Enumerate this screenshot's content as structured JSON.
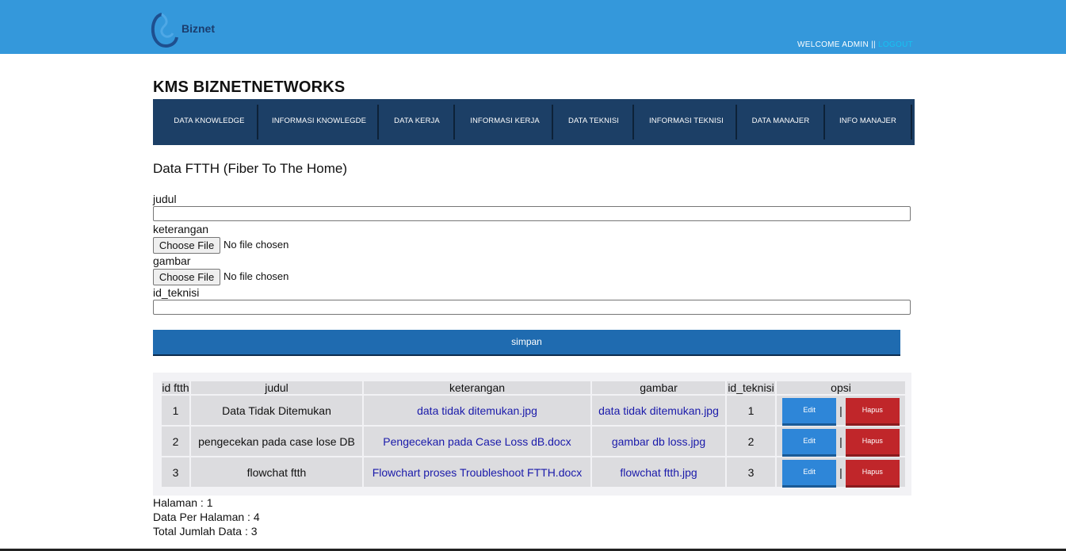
{
  "header": {
    "logo_text": "Biznet",
    "welcome_text": "WELCOME ADMIN || ",
    "logout_label": "LOGOUT",
    "colors": {
      "bar": "#3498db",
      "logout": "#16c2f2"
    }
  },
  "site_title": "KMS BIZNETNETWORKS",
  "nav": {
    "items": [
      "DATA KNOWLEDGE",
      "INFORMASI KNOWLEGDE",
      "DATA KERJA",
      "INFORMASI KERJA",
      "DATA TEKNISI",
      "INFORMASI TEKNISI",
      "DATA MANAJER",
      "INFO MANAJER"
    ],
    "color": "#1c3f66"
  },
  "page_heading": "Data FTTH (Fiber To The Home)",
  "form": {
    "judul_label": "judul",
    "judul_value": "",
    "keterangan_label": "keterangan",
    "gambar_label": "gambar",
    "choose_file_label": "Choose File",
    "no_file_text": "No file chosen",
    "id_teknisi_label": "id_teknisi",
    "id_teknisi_value": "",
    "save_label": "simpan"
  },
  "table": {
    "headers": [
      "id ftth",
      "judul",
      "keterangan",
      "gambar",
      "id_teknisi",
      "opsi"
    ],
    "rows": [
      {
        "id": "1",
        "judul": "Data Tidak Ditemukan",
        "keterangan": "data tidak ditemukan.jpg",
        "gambar": "data tidak ditemukan.jpg",
        "id_teknisi": "1"
      },
      {
        "id": "2",
        "judul": "pengecekan pada case lose DB",
        "keterangan": "Pengecekan pada Case Loss dB.docx",
        "gambar": "gambar db loss.jpg",
        "id_teknisi": "2"
      },
      {
        "id": "3",
        "judul": "flowchat ftth",
        "keterangan": "Flowchart proses Troubleshoot FTTH.docx",
        "gambar": "flowchat ftth.jpg",
        "id_teknisi": "3"
      }
    ],
    "edit_label": "Edit",
    "delete_label": "Hapus",
    "separator": "|",
    "colors": {
      "edit": "#2e86d8",
      "delete": "#c0262a",
      "link": "#1a1aaa"
    }
  },
  "pagination": {
    "page_text": "Halaman : 1",
    "per_page_text": "Data Per Halaman : 4",
    "total_text": "Total Jumlah Data : 3"
  }
}
